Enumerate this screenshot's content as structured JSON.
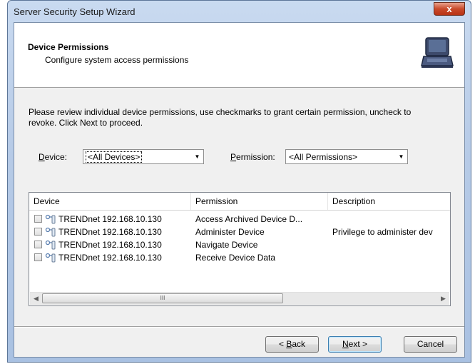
{
  "window": {
    "title": "Server Security Setup Wizard",
    "close_glyph": "x"
  },
  "header": {
    "title": "Device Permissions",
    "subtitle": "Configure system access permissions",
    "icon": "laptop-icon"
  },
  "instructions": "Please review individual device permissions, use checkmarks to grant certain permission, uncheck to revoke. Click Next to proceed.",
  "filters": {
    "device_label_key": "D",
    "device_label_rest": "evice:",
    "device_value": "<All Devices>",
    "permission_label_key": "P",
    "permission_label_rest": "ermission:",
    "permission_value": "<All Permissions>"
  },
  "list": {
    "columns": [
      "Device",
      "Permission",
      "Description"
    ],
    "rows": [
      {
        "device": "TRENDnet 192.168.10.130",
        "permission": "Access Archived Device D...",
        "description": "",
        "checked": false
      },
      {
        "device": "TRENDnet 192.168.10.130",
        "permission": "Administer Device",
        "description": "Privilege to administer dev",
        "checked": false
      },
      {
        "device": "TRENDnet 192.168.10.130",
        "permission": "Navigate Device",
        "description": "",
        "checked": false
      },
      {
        "device": "TRENDnet 192.168.10.130",
        "permission": "Receive Device Data",
        "description": "",
        "checked": false
      }
    ],
    "scrollbar_thumb_glyph": "III"
  },
  "buttons": {
    "back_pre": "< ",
    "back_key": "B",
    "back_rest": "ack",
    "next_key": "N",
    "next_rest": "ext >",
    "cancel": "Cancel"
  },
  "colors": {
    "title_bar": "#b7cbe7",
    "close_button": "#c94a2b",
    "dialog_bg": "#f0f0f0"
  }
}
